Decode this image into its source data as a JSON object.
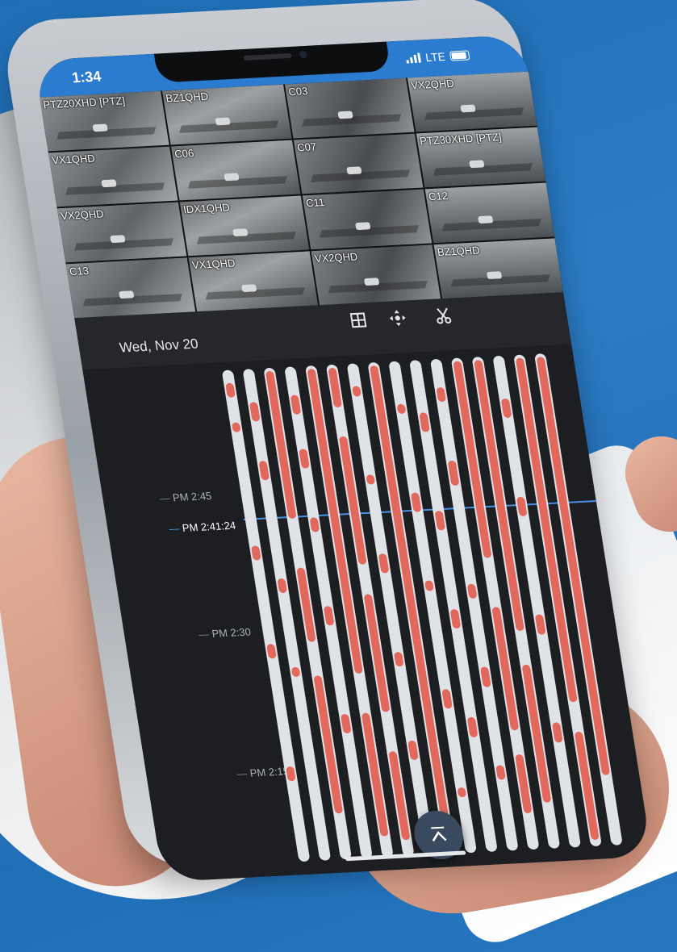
{
  "status_bar": {
    "time": "1:34",
    "network": "LTE"
  },
  "cameras": [
    {
      "label": "PTZ20XHD [PTZ]"
    },
    {
      "label": "BZ1QHD"
    },
    {
      "label": "C03"
    },
    {
      "label": "VX2QHD"
    },
    {
      "label": "VX1QHD"
    },
    {
      "label": "C06"
    },
    {
      "label": "C07"
    },
    {
      "label": "PTZ30XHD [PTZ]"
    },
    {
      "label": "VX2QHD"
    },
    {
      "label": "IDX1QHD"
    },
    {
      "label": "C11"
    },
    {
      "label": "C12"
    },
    {
      "label": "C13"
    },
    {
      "label": "VX1QHD"
    },
    {
      "label": "VX2QHD"
    },
    {
      "label": "BZ1QHD"
    }
  ],
  "toolbar": {
    "date": "Wed, Nov 20",
    "grid_icon": "grid-layout-icon",
    "ptz_icon": "ptz-move-icon",
    "clip_icon": "scissors-icon"
  },
  "timeline": {
    "ticks": [
      {
        "label": "PM 2:45"
      },
      {
        "label": "PM 2:41:24",
        "current": true
      },
      {
        "label": "PM 2:30"
      },
      {
        "label": "PM 2:15"
      }
    ],
    "track_count": 16,
    "colors": {
      "track_bg": "#dfe2e6",
      "recording": "#e3685c",
      "current_line": "#4a90e2"
    },
    "tracks": [
      [
        [
          0.02,
          0.05
        ],
        [
          0.1,
          0.12
        ],
        [
          0.35,
          0.38
        ],
        [
          0.55,
          0.58
        ],
        [
          0.8,
          0.83
        ]
      ],
      [
        [
          0.06,
          0.1
        ],
        [
          0.18,
          0.22
        ],
        [
          0.42,
          0.45
        ],
        [
          0.6,
          0.62
        ]
      ],
      [
        [
          0.0,
          0.3
        ],
        [
          0.4,
          0.55
        ],
        [
          0.62,
          0.9
        ]
      ],
      [
        [
          0.05,
          0.09
        ],
        [
          0.16,
          0.2
        ],
        [
          0.3,
          0.33
        ],
        [
          0.48,
          0.52
        ],
        [
          0.7,
          0.74
        ]
      ],
      [
        [
          0.0,
          0.62
        ],
        [
          0.7,
          0.95
        ]
      ],
      [
        [
          0.0,
          0.08
        ],
        [
          0.14,
          0.4
        ],
        [
          0.46,
          0.7
        ],
        [
          0.78,
          0.96
        ]
      ],
      [
        [
          0.04,
          0.06
        ],
        [
          0.22,
          0.24
        ],
        [
          0.38,
          0.42
        ],
        [
          0.58,
          0.61
        ],
        [
          0.76,
          0.8
        ]
      ],
      [
        [
          0.0,
          0.92
        ]
      ],
      [
        [
          0.08,
          0.1
        ],
        [
          0.26,
          0.3
        ],
        [
          0.44,
          0.46
        ],
        [
          0.66,
          0.7
        ],
        [
          0.86,
          0.88
        ]
      ],
      [
        [
          0.1,
          0.14
        ],
        [
          0.3,
          0.34
        ],
        [
          0.5,
          0.54
        ],
        [
          0.72,
          0.76
        ]
      ],
      [
        [
          0.05,
          0.08
        ],
        [
          0.2,
          0.25
        ],
        [
          0.45,
          0.48
        ],
        [
          0.62,
          0.66
        ],
        [
          0.82,
          0.85
        ]
      ],
      [
        [
          0.0,
          0.4
        ],
        [
          0.5,
          0.75
        ],
        [
          0.8,
          0.92
        ]
      ],
      [
        [
          0.0,
          0.55
        ],
        [
          0.62,
          0.9
        ]
      ],
      [
        [
          0.08,
          0.12
        ],
        [
          0.28,
          0.32
        ],
        [
          0.52,
          0.56
        ],
        [
          0.74,
          0.78
        ]
      ],
      [
        [
          0.0,
          0.7
        ],
        [
          0.76,
          0.98
        ]
      ],
      [
        [
          0.0,
          0.85
        ]
      ]
    ]
  }
}
